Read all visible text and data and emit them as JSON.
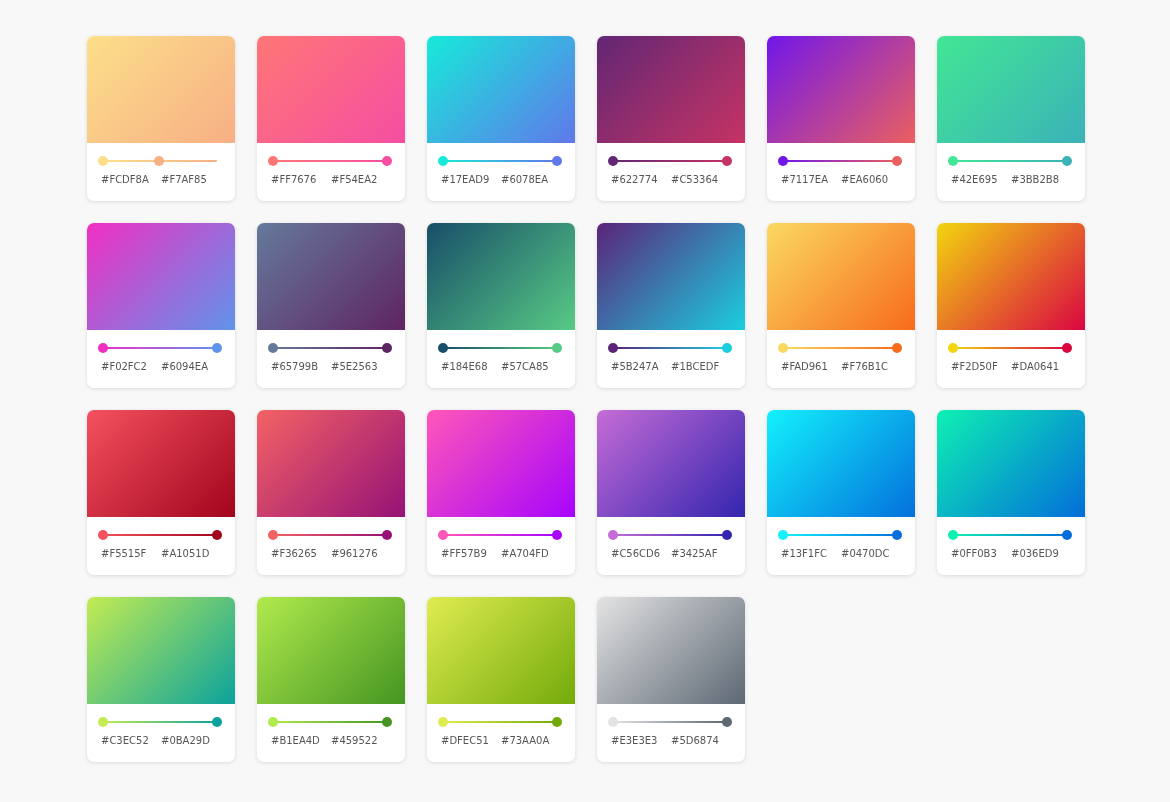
{
  "gradients": [
    {
      "start": {
        "label": "#FCDF8A",
        "color": "#fcdf8a"
      },
      "end": {
        "label": "#F7AF85",
        "color": "#f7af85"
      },
      "level": 0.49
    },
    {
      "start": {
        "label": "#FF7676",
        "color": "#ff7676"
      },
      "end": {
        "label": "#F54EA2",
        "color": "#f54ea2"
      },
      "level": 1
    },
    {
      "start": {
        "label": "#17EAD9",
        "color": "#17ead9"
      },
      "end": {
        "label": "#6078EA",
        "color": "#6078ea"
      },
      "level": 1
    },
    {
      "start": {
        "label": "#622774",
        "color": "#622774"
      },
      "end": {
        "label": "#C53364",
        "color": "#c53364"
      },
      "level": 1
    },
    {
      "start": {
        "label": "#7117EA",
        "color": "#7117ea"
      },
      "end": {
        "label": "#EA6060",
        "color": "#ea6060"
      },
      "level": 1
    },
    {
      "start": {
        "label": "#42E695",
        "color": "#42e695"
      },
      "end": {
        "label": "#3BB2B8",
        "color": "#3bb2b8"
      },
      "level": 1
    },
    {
      "start": {
        "label": "#F02FC2",
        "color": "#f02fc2"
      },
      "end": {
        "label": "#6094EA",
        "color": "#6094ea"
      },
      "level": 1
    },
    {
      "start": {
        "label": "#65799B",
        "color": "#65799b"
      },
      "end": {
        "label": "#5E2563",
        "color": "#5e2563"
      },
      "level": 1
    },
    {
      "start": {
        "label": "#184E68",
        "color": "#184e68"
      },
      "end": {
        "label": "#57CA85",
        "color": "#57ca85"
      },
      "level": 1
    },
    {
      "start": {
        "label": "#5B247A",
        "color": "#5b247a"
      },
      "end": {
        "label": "#1BCEDF",
        "color": "#1bcedf"
      },
      "level": 1
    },
    {
      "start": {
        "label": "#FAD961",
        "color": "#fad961"
      },
      "end": {
        "label": "#F76B1C",
        "color": "#f76b1c"
      },
      "level": 1
    },
    {
      "start": {
        "label": "#F2D50F",
        "color": "#f2d50f"
      },
      "end": {
        "label": "#DA0641",
        "color": "#da0641"
      },
      "level": 1
    },
    {
      "start": {
        "label": "#F5515F",
        "color": "#f5515f"
      },
      "end": {
        "label": "#A1051D",
        "color": "#a1051d"
      },
      "level": 1
    },
    {
      "start": {
        "label": "#F36265",
        "color": "#f36265"
      },
      "end": {
        "label": "#961276",
        "color": "#961276"
      },
      "level": 1
    },
    {
      "start": {
        "label": "#FF57B9",
        "color": "#ff57b9"
      },
      "end": {
        "label": "#A704FD",
        "color": "#a704fd"
      },
      "level": 1
    },
    {
      "start": {
        "label": "#C56CD6",
        "color": "#c56cd6"
      },
      "end": {
        "label": "#3425AF",
        "color": "#3425af"
      },
      "level": 1
    },
    {
      "start": {
        "label": "#13F1FC",
        "color": "#13f1fc"
      },
      "end": {
        "label": "#0470DC",
        "color": "#0470dc"
      },
      "level": 1
    },
    {
      "start": {
        "label": "#0FF0B3",
        "color": "#0ff0b3"
      },
      "end": {
        "label": "#036ED9",
        "color": "#036ed9"
      },
      "level": 1
    },
    {
      "start": {
        "label": "#C3EC52",
        "color": "#c3ec52"
      },
      "end": {
        "label": "#0BA29D",
        "color": "#0ba29d"
      },
      "level": 1
    },
    {
      "start": {
        "label": "#B1EA4D",
        "color": "#b1ea4d"
      },
      "end": {
        "label": "#459522",
        "color": "#459522"
      },
      "level": 1
    },
    {
      "start": {
        "label": "#DFEC51",
        "color": "#dfec51"
      },
      "end": {
        "label": "#73AA0A",
        "color": "#73aa0a"
      },
      "level": 1
    },
    {
      "start": {
        "label": "#E3E3E3",
        "color": "#e3e3e3"
      },
      "end": {
        "label": "#5D6874",
        "color": "#5d6874"
      },
      "level": 1
    }
  ]
}
